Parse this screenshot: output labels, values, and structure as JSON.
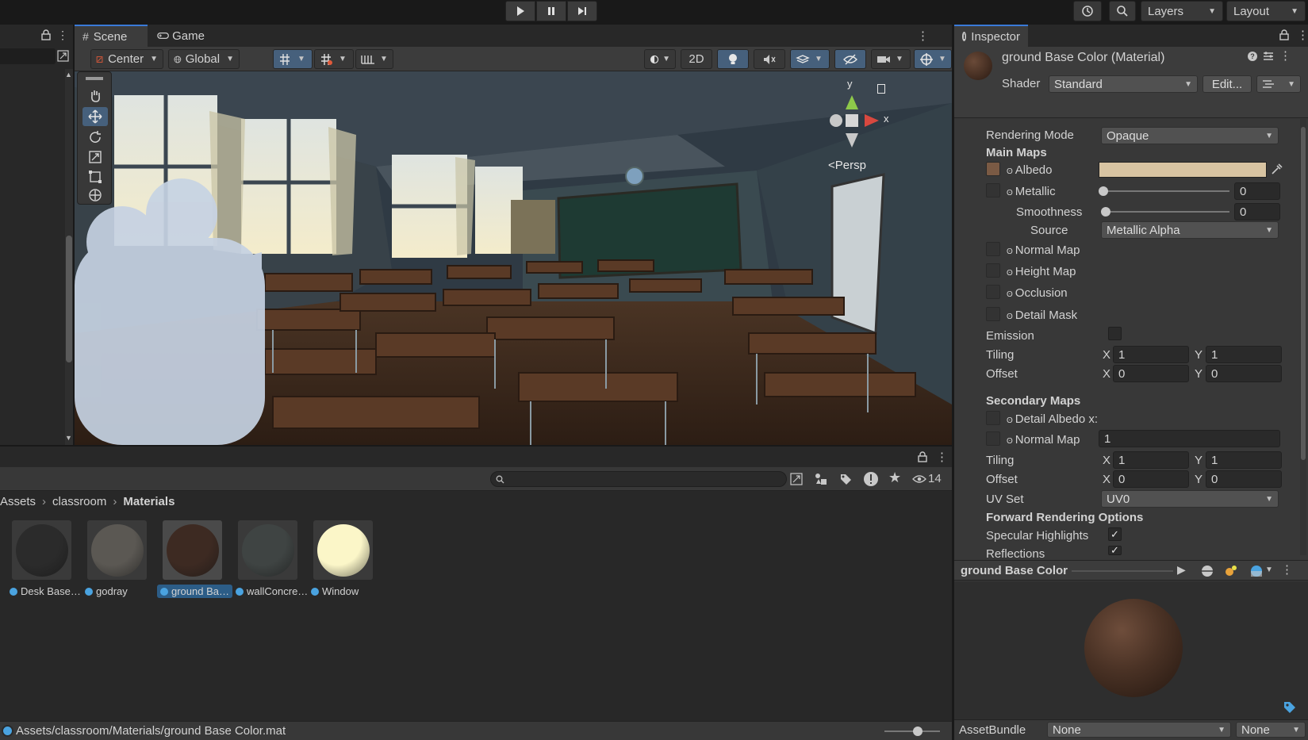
{
  "toolbar": {
    "play_icon": "play-icon",
    "pause_icon": "pause-icon",
    "step_icon": "step-icon",
    "layers_label": "Layers",
    "layout_label": "Layout"
  },
  "scene": {
    "tab_scene": "Scene",
    "tab_game": "Game",
    "pivot_label": "Center",
    "space_label": "Global",
    "mode_2d": "2D",
    "orientation_label": "Persp",
    "gizmo_y": "y",
    "gizmo_x": "x"
  },
  "project": {
    "breadcrumb": [
      "Assets",
      "classroom",
      "Materials"
    ],
    "hidden_count": "14",
    "search_placeholder": "",
    "assets": [
      {
        "label": "Desk Base…",
        "color": "#2b2b2b"
      },
      {
        "label": "godray",
        "color": "#5b5853"
      },
      {
        "label": "ground Ba…",
        "color": "#3d2a22",
        "selected": true
      },
      {
        "label": "wallConcre…",
        "color": "#3f4443"
      },
      {
        "label": "Window",
        "color": "#fbf6c8"
      }
    ],
    "status_path": "Assets/classroom/Materials/ground Base Color.mat"
  },
  "inspector": {
    "tab_label": "Inspector",
    "material_title": "ground Base Color (Material)",
    "shader_label": "Shader",
    "shader_value": "Standard",
    "edit_button": "Edit...",
    "rendering_mode_label": "Rendering Mode",
    "rendering_mode_value": "Opaque",
    "main_maps_header": "Main Maps",
    "albedo_label": "Albedo",
    "albedo_color": "#d8c4a2",
    "metallic_label": "Metallic",
    "metallic_value": "0",
    "smoothness_label": "Smoothness",
    "smoothness_value": "0",
    "source_label": "Source",
    "source_value": "Metallic Alpha",
    "normal_map_label": "Normal Map",
    "height_map_label": "Height Map",
    "occlusion_label": "Occlusion",
    "detail_mask_label": "Detail Mask",
    "emission_label": "Emission",
    "tiling_label": "Tiling",
    "offset_label": "Offset",
    "x_label": "X",
    "y_label": "Y",
    "tiling_x": "1",
    "tiling_y": "1",
    "offset_x": "0",
    "offset_y": "0",
    "secondary_maps_header": "Secondary Maps",
    "detail_albedo_label": "Detail Albedo x:",
    "secondary_normal_label": "Normal Map",
    "secondary_normal_value": "1",
    "sec_tiling_label": "Tiling",
    "sec_offset_label": "Offset",
    "sec_tiling_x": "1",
    "sec_tiling_y": "1",
    "sec_offset_x": "0",
    "sec_offset_y": "0",
    "uv_set_label": "UV Set",
    "uv_set_value": "UV0",
    "forward_header": "Forward Rendering Options",
    "specular_label": "Specular Highlights",
    "specular_checked": "✓",
    "reflections_label": "Reflections",
    "reflections_checked": "✓",
    "preview_title": "ground Base Color",
    "assetbundle_label": "AssetBundle",
    "assetbundle_value": "None",
    "assetbundle_variant": "None"
  }
}
